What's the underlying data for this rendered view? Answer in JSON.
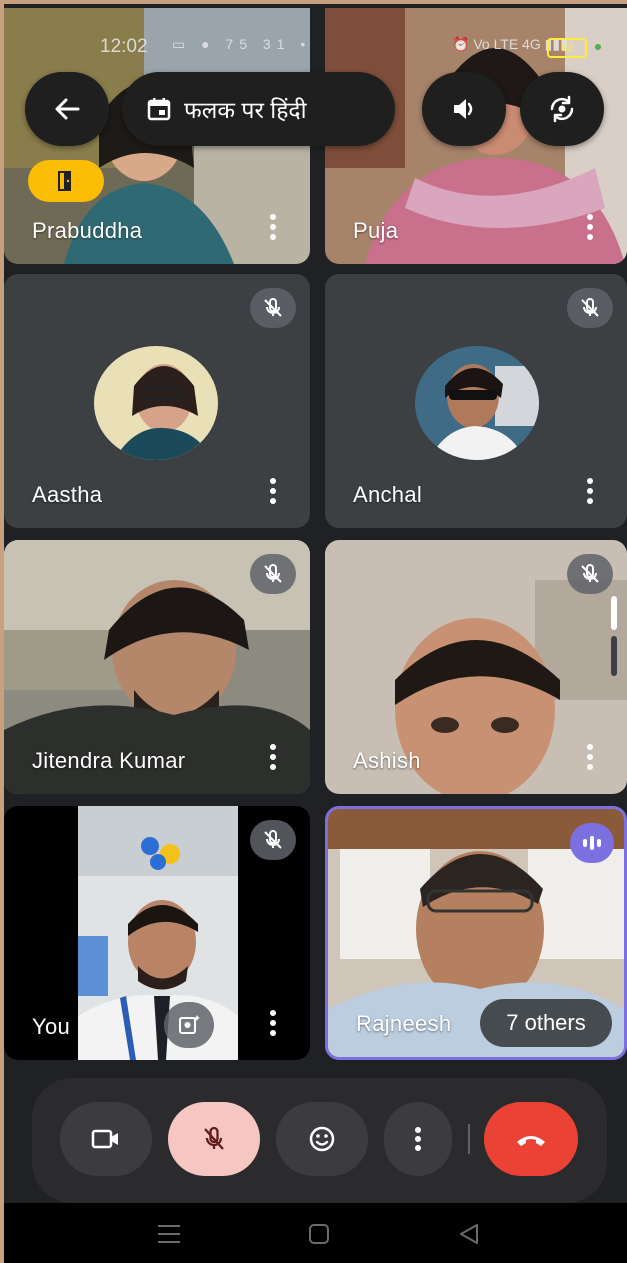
{
  "status_bar": {
    "time": "12:02",
    "left_icons": "▭ ● 75 31 •",
    "right_icons": "⏰ Vo LTE 4G ▮▮▮",
    "battery": "62"
  },
  "top_bar": {
    "meeting_title": "फलक पर हिंदी"
  },
  "participants": [
    {
      "name": "Prabuddha",
      "muted": false
    },
    {
      "name": "Puja",
      "muted": false
    },
    {
      "name": "Aastha",
      "muted": true
    },
    {
      "name": "Anchal",
      "muted": true
    },
    {
      "name": "Jitendra Kumar",
      "muted": true
    },
    {
      "name": "Ashish",
      "muted": true
    },
    {
      "name": "You",
      "muted": true
    },
    {
      "name": "Rajneesh",
      "muted": false,
      "others": "7 others"
    }
  ],
  "colors": {
    "end_call_red": "#ea4335",
    "mic_off_pink": "#f6c6c3",
    "speaking_purple": "#7c6fe0",
    "hand_badge_yellow": "#fbbc04"
  }
}
